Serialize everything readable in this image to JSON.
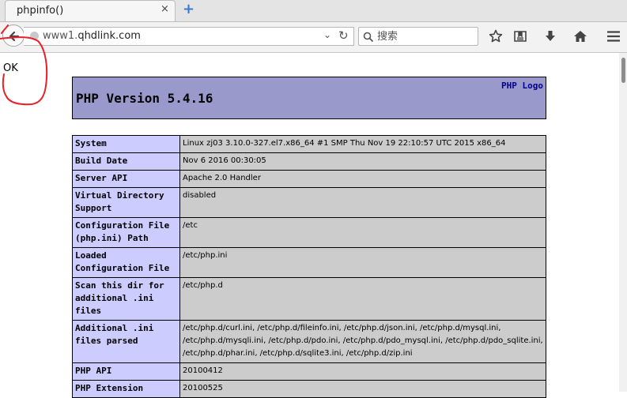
{
  "browser": {
    "tab": {
      "title": "phpinfo()",
      "close": "×"
    },
    "new_tab": "+",
    "url": {
      "scheme_prefix": "www1.",
      "host": "qhdlink.com"
    },
    "search": {
      "placeholder": "搜索"
    },
    "toolbar_icons": [
      "back-arrow-icon",
      "globe-icon",
      "dropdown-icon",
      "reload-icon",
      "search-icon",
      "bookmark-star-icon",
      "reading-list-icon",
      "download-icon",
      "home-icon",
      "menu-icon"
    ]
  },
  "annotation": {
    "text": "OK",
    "color": "#e8202a"
  },
  "php": {
    "version": "PHP Version 5.4.16",
    "logo": "PHP Logo",
    "header_color": "#9999cc",
    "rows": [
      {
        "key": "System",
        "value": "Linux zj03 3.10.0-327.el7.x86_64 #1 SMP Thu Nov 19 22:10:57 UTC 2015 x86_64"
      },
      {
        "key": "Build Date",
        "value": "Nov 6 2016 00:30:05"
      },
      {
        "key": "Server API",
        "value": "Apache 2.0 Handler"
      },
      {
        "key": "Virtual Directory Support",
        "value": "disabled"
      },
      {
        "key": "Configuration File (php.ini) Path",
        "value": "/etc"
      },
      {
        "key": "Loaded Configuration File",
        "value": "/etc/php.ini"
      },
      {
        "key": "Scan this dir for additional .ini files",
        "value": "/etc/php.d"
      },
      {
        "key": "Additional .ini files parsed",
        "value": "/etc/php.d/curl.ini, /etc/php.d/fileinfo.ini, /etc/php.d/json.ini, /etc/php.d/mysql.ini, /etc/php.d/mysqli.ini, /etc/php.d/pdo.ini, /etc/php.d/pdo_mysql.ini, /etc/php.d/pdo_sqlite.ini, /etc/php.d/phar.ini, /etc/php.d/sqlite3.ini, /etc/php.d/zip.ini"
      },
      {
        "key": "PHP API",
        "value": "20100412"
      },
      {
        "key": "PHP Extension",
        "value": "20100525"
      }
    ]
  }
}
